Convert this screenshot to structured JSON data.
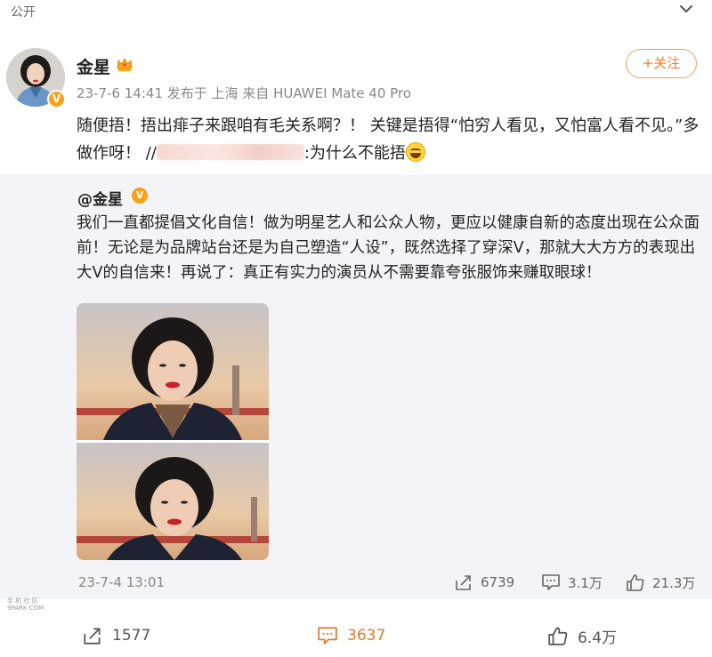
{
  "header": {
    "visibility": "公开"
  },
  "post": {
    "author": "金星",
    "meta": "23-7-6 14:41  发布于 上海  来自 HUAWEI Mate 40 Pro",
    "follow_label": "+关注",
    "text_part1": "随便捂！捂出痱子来跟咱有毛关系啊？！ 关键是捂得“怕穷人看见，又怕富人看不见。”多做作呀！ //",
    "text_part2": ":为什么不能捂",
    "avatar_badge": "V"
  },
  "repost": {
    "author": "@金星",
    "badge": "V",
    "text": "我们一直都提倡文化自信！做为明星艺人和公众人物，更应以健康自新的态度出现在公众面前！无论是为品牌站台还是为自己塑造“人设”，既然选择了穿深V，那就大大方方的表现出大V的自信来！再说了：真正有实力的演员从不需要靠夸张服饰来赚取眼球！",
    "time": "23-7-4 13:01",
    "share_count": "6739",
    "comment_count": "3.1万",
    "like_count": "21.3万"
  },
  "watermark": {
    "line1": "手 机 社 区",
    "line2": "9PARK·COM"
  },
  "actions": {
    "share_count": "1577",
    "comment_count": "3637",
    "like_count": "6.4万"
  },
  "colors": {
    "accent": "#f07a2a",
    "repost_bg": "#f3f4f7"
  }
}
